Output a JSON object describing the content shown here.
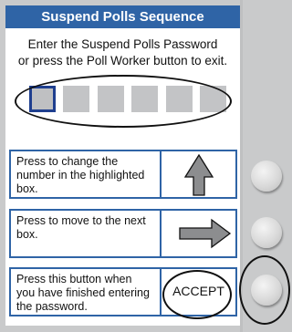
{
  "screen": {
    "title": "Suspend Polls Sequence",
    "instruction_line1": "Enter the Suspend Polls Password",
    "instruction_line2": "or press the Poll Worker button to exit."
  },
  "password": {
    "slot_count": 6,
    "active_slot": 1
  },
  "rows": [
    {
      "description": "Press to change the number in the highlighted box.",
      "icon": "up-arrow-icon"
    },
    {
      "description": "Press to move to the next box.",
      "icon": "right-arrow-icon"
    },
    {
      "description": "Press this button when you have finished entering the password.",
      "button_label": "ACCEPT"
    }
  ],
  "colors": {
    "accent": "#2f64a6",
    "highlight_border": "#1f3f8f",
    "slot": "#c3c4c6",
    "arrow": "#8c8d8f",
    "device_body": "#c9cacb"
  }
}
